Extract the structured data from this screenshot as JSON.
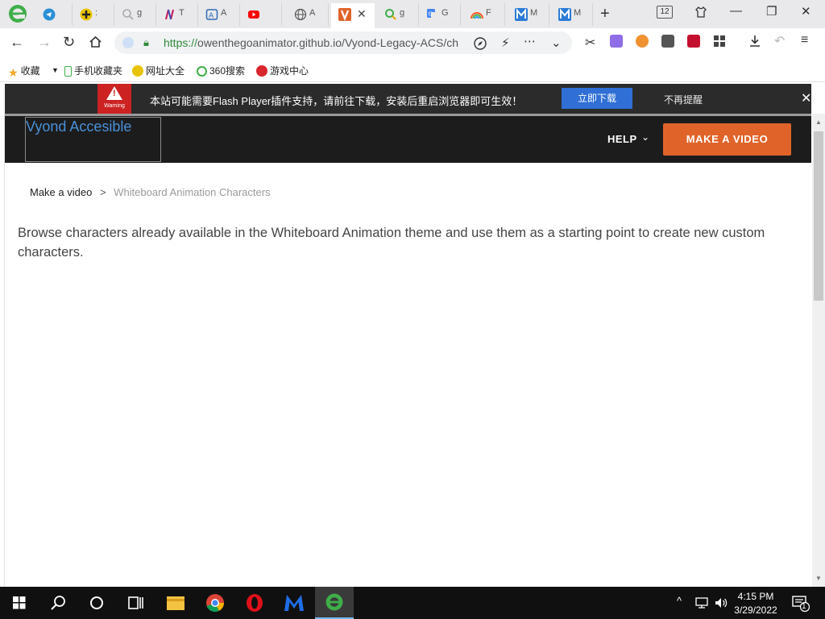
{
  "browser": {
    "tabs": [
      {
        "title": "g",
        "icon": "search-icon"
      },
      {
        "title": "T",
        "icon": "app-icon"
      },
      {
        "title": "A",
        "icon": "translate-icon"
      },
      {
        "title": "",
        "icon": "youtube-icon"
      },
      {
        "title": "A",
        "icon": "globe-icon"
      },
      {
        "title": "",
        "icon": "vyond-icon",
        "active": true
      },
      {
        "title": "g",
        "icon": "search-icon"
      },
      {
        "title": "G",
        "icon": "google-translate-icon"
      },
      {
        "title": "F",
        "icon": "rainbow-icon"
      },
      {
        "title": "M",
        "icon": "m-icon"
      },
      {
        "title": "M",
        "icon": "m-icon"
      }
    ],
    "tab_count": "12",
    "url_scheme": "https://",
    "url_rest": "owenthegoanimator.github.io/Vyond-Legacy-ACS/ch",
    "bookmarks": [
      "收藏",
      "手机收藏夹",
      "网址大全",
      "360搜索",
      "游戏中心"
    ]
  },
  "flash_banner": {
    "warning_label": "Warning",
    "message": "本站可能需要Flash Player插件支持，请前往下载，安装后重启浏览器即可生效！",
    "download_label": "立即下载",
    "dismiss_label": "不再提醒"
  },
  "site": {
    "logo_alt": "Vyond Accesible",
    "help_label": "HELP",
    "make_video_label": "MAKE A VIDEO"
  },
  "breadcrumb": {
    "parent": "Make a video",
    "separator": ">",
    "current": "Whiteboard Animation Characters"
  },
  "description": "Browse characters already available in the Whiteboard Animation theme and use them as a starting point to create new custom characters.",
  "taskbar": {
    "time": "4:15 PM",
    "date": "3/29/2022",
    "notification_count": "1"
  },
  "colors": {
    "accent_orange": "#e0642a",
    "download_blue": "#2f6fd6",
    "header_dark": "#1c1c1c"
  }
}
